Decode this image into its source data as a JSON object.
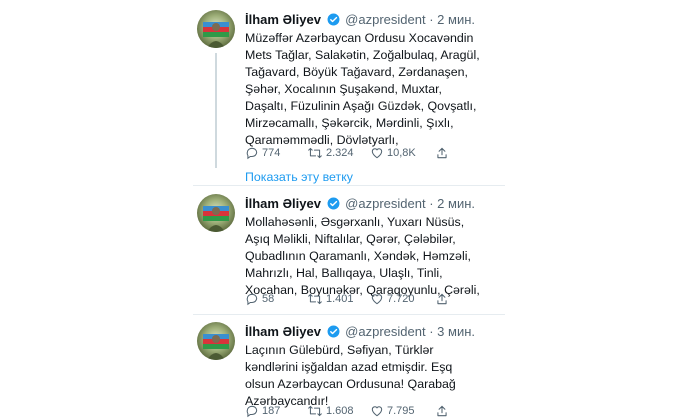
{
  "tweets": [
    {
      "author": "İlham Əliyev",
      "handle": "@azpresident",
      "separator": "·",
      "time": "2 мин.",
      "lines": [
        "Müzəffər Azərbaycan Ordusu Xocavəndin",
        "Mets Tağlar, Salakətin, Zoğalbulaq, Aragül,",
        "Tağavard, Böyük Tağavard, Zərdanaşen,",
        "Şəhər, Xocalının Şuşakənd, Muxtar,",
        "Daşaltı, Füzulinin Aşağı Güzdək, Qovşatlı,",
        "Mirzəcamallı, Şəkərcik, Mərdinli, Şıxlı,",
        "Qaraməmmədli, Dövlətyarlı,"
      ],
      "replies": "774",
      "retweets": "2.324",
      "likes": "10,8K"
    },
    {
      "author": "İlham Əliyev",
      "handle": "@azpresident",
      "separator": "·",
      "time": "2 мин.",
      "lines": [
        "Mollahəsənli, Əsgərxanlı, Yuxarı Nüsüs,",
        "Aşıq Məlikli, Niftalılar, Qərər, Çələbilər,",
        "Qubadlının Qaramanlı, Xəndək, Həmzəli,",
        "Mahrızlı, Hal, Ballıqaya, Ulaşlı, Tinli,",
        "Xocahan, Boyunəkər, Qaraqoyunlu, Çərəli,"
      ],
      "replies": "58",
      "retweets": "1.401",
      "likes": "7.720"
    },
    {
      "author": "İlham Əliyev",
      "handle": "@azpresident",
      "separator": "·",
      "time": "3 мин.",
      "lines": [
        "Laçının Gülebürd, Səfiyan, Türklər",
        "kəndlərini işğaldan azad etmişdir. Eşq",
        "olsun Azərbaycan Ordusuna! Qarabağ",
        "Azərbaycandır!"
      ],
      "replies": "187",
      "retweets": "1.608",
      "likes": "7.795"
    }
  ],
  "show_thread_label": "Показать эту ветку",
  "colors": {
    "link_blue": "#1d9bf0",
    "verified_blue": "#1d9bf0",
    "secondary_text": "#536471",
    "divider": "#e6ecf0"
  },
  "icons": {
    "reply": "reply-icon",
    "retweet": "retweet-icon",
    "like": "heart-icon",
    "share": "share-icon",
    "verified": "verified-badge-icon"
  }
}
